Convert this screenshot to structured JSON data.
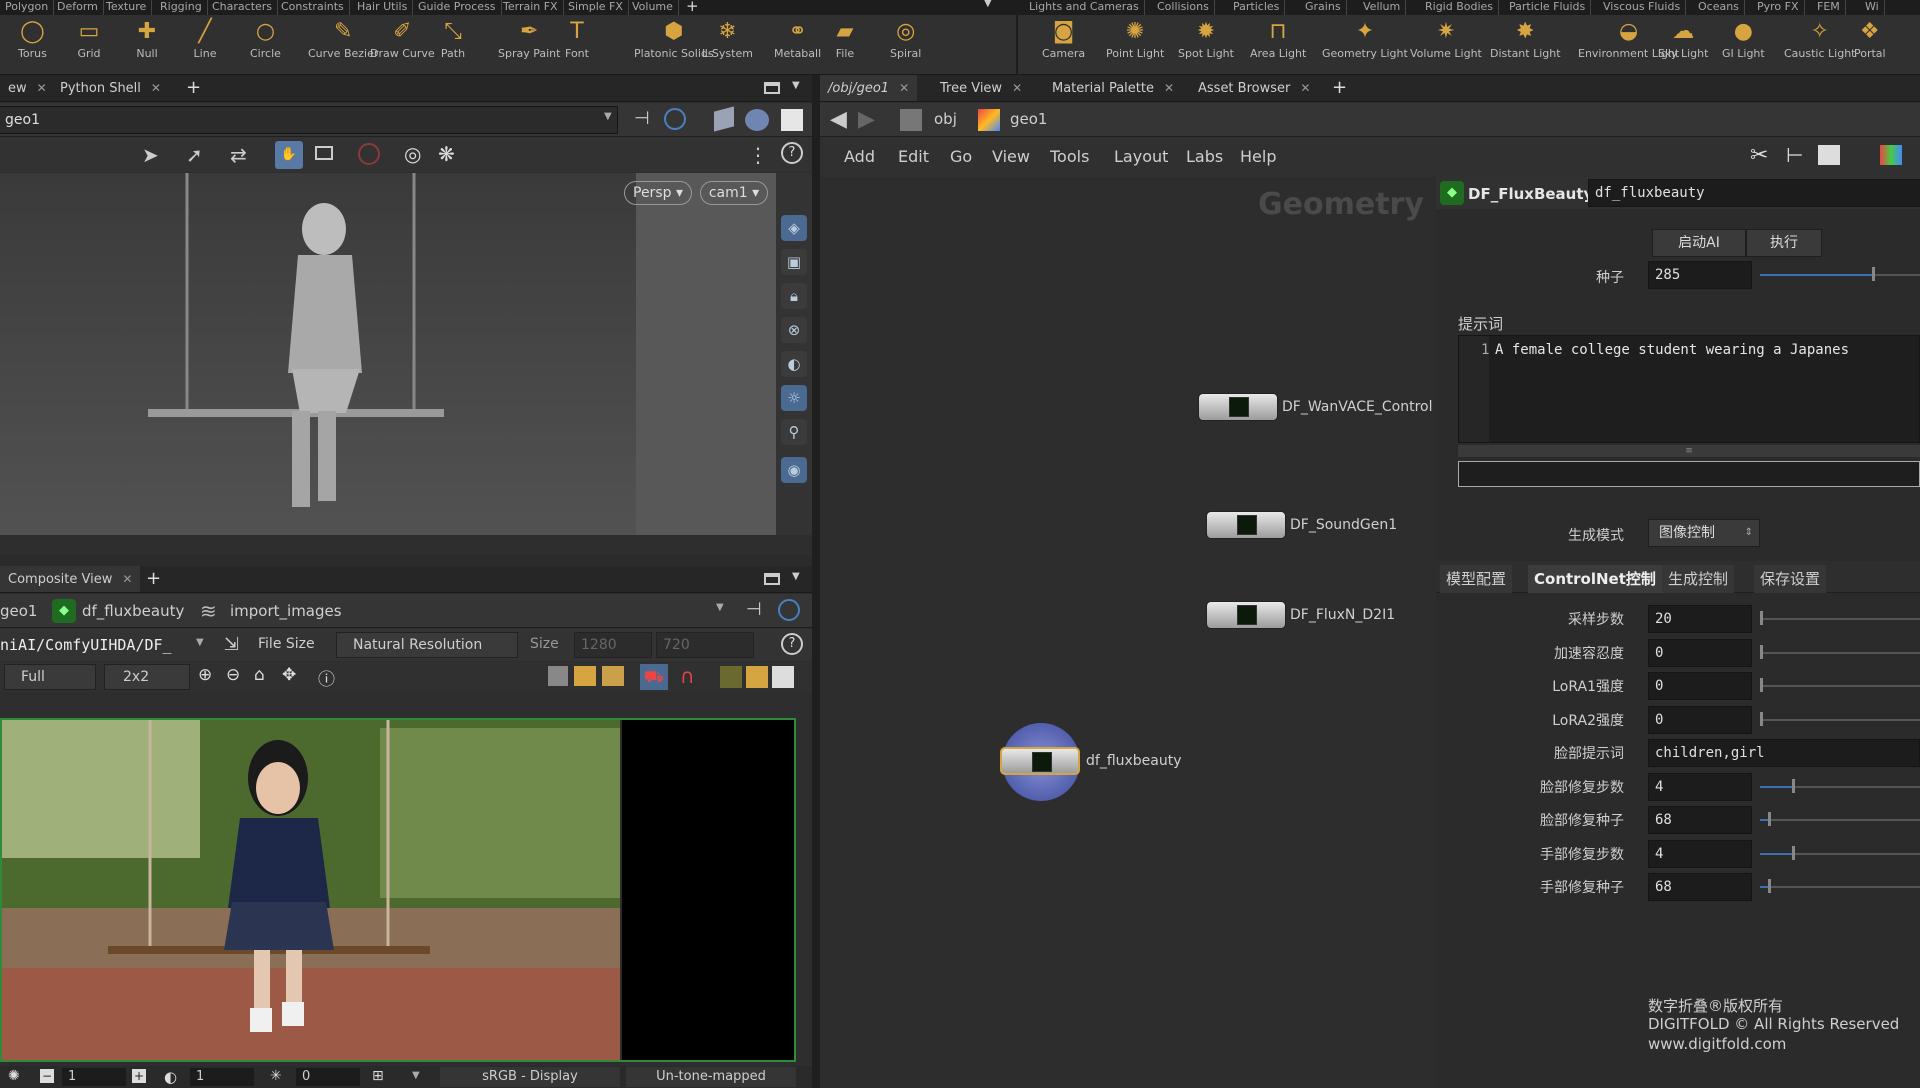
{
  "shelf_tabs_left": [
    "Polygon",
    "Deform",
    "Texture",
    "Rigging",
    "Characters",
    "Constraints",
    "Hair Utils",
    "Guide Process",
    "Terrain FX",
    "Simple FX",
    "Volume"
  ],
  "shelf_tabs_right": [
    "Lights and Cameras",
    "Collisions",
    "Particles",
    "Grains",
    "Vellum",
    "Rigid Bodies",
    "Particle Fluids",
    "Viscous Fluids",
    "Oceans",
    "Pyro FX",
    "FEM",
    "Wi"
  ],
  "tools_left": [
    {
      "label": "Torus",
      "icon": "torus-icon",
      "glyph": "◯"
    },
    {
      "label": "Grid",
      "icon": "grid-icon",
      "glyph": "▭"
    },
    {
      "label": "Null",
      "icon": "null-icon",
      "glyph": "✚"
    },
    {
      "label": "Line",
      "icon": "line-icon",
      "glyph": "╱"
    },
    {
      "label": "Circle",
      "icon": "circle-icon",
      "glyph": "○"
    },
    {
      "label": "Curve Bezier",
      "icon": "curve-bezier-icon",
      "glyph": "✎"
    },
    {
      "label": "Draw Curve",
      "icon": "draw-curve-icon",
      "glyph": "✐"
    },
    {
      "label": "Path",
      "icon": "path-icon",
      "glyph": "⤡"
    },
    {
      "label": "Spray Paint",
      "icon": "spray-paint-icon",
      "glyph": "✒"
    },
    {
      "label": "Font",
      "icon": "font-icon",
      "glyph": "T"
    },
    {
      "label": "Platonic Solids",
      "icon": "platonic-solids-icon",
      "glyph": "⬢"
    },
    {
      "label": "L-System",
      "icon": "l-system-icon",
      "glyph": "❄"
    },
    {
      "label": "Metaball",
      "icon": "metaball-icon",
      "glyph": "⚭"
    },
    {
      "label": "File",
      "icon": "file-icon",
      "glyph": "▰"
    },
    {
      "label": "Spiral",
      "icon": "spiral-icon",
      "glyph": "◎"
    }
  ],
  "tools_right": [
    {
      "label": "Camera",
      "icon": "camera-icon",
      "glyph": "◙"
    },
    {
      "label": "Point Light",
      "icon": "point-light-icon",
      "glyph": "✺"
    },
    {
      "label": "Spot Light",
      "icon": "spot-light-icon",
      "glyph": "✹"
    },
    {
      "label": "Area Light",
      "icon": "area-light-icon",
      "glyph": "⊓"
    },
    {
      "label": "Geometry Light",
      "icon": "geometry-light-icon",
      "glyph": "✦"
    },
    {
      "label": "Volume Light",
      "icon": "volume-light-icon",
      "glyph": "✷"
    },
    {
      "label": "Distant Light",
      "icon": "distant-light-icon",
      "glyph": "✸"
    },
    {
      "label": "Environment Light",
      "icon": "environment-light-icon",
      "glyph": "◒"
    },
    {
      "label": "Sky Light",
      "icon": "sky-light-icon",
      "glyph": "☁"
    },
    {
      "label": "GI Light",
      "icon": "gi-light-icon",
      "glyph": "●"
    },
    {
      "label": "Caustic Light",
      "icon": "caustic-light-icon",
      "glyph": "✧"
    },
    {
      "label": "Portal",
      "icon": "portal-light-icon",
      "glyph": "❖"
    }
  ],
  "left_top": {
    "tabs": [
      "ew",
      "Python Shell"
    ],
    "path": "geo1",
    "camera_menu": "Persp",
    "cam_menu": "cam1"
  },
  "left_bottom": {
    "tab": "Composite View",
    "crumbs": [
      "geo1",
      "df_fluxbeauty",
      "import_images"
    ],
    "path": "niAI/ComfyUIHDA/DF_",
    "size_mode": "File Size",
    "resolution": "Natural Resolution",
    "size_label": "Size",
    "width": "1280",
    "height": "720",
    "zoom": "Full",
    "grid": "2x2",
    "bottom": {
      "val1": "1",
      "val2": "1",
      "val3": "0",
      "display": "sRGB - Display",
      "tonemap": "Un-tone-mapped"
    }
  },
  "network": {
    "tabs": [
      "/obj/geo1",
      "Tree View",
      "Material Palette",
      "Asset Browser"
    ],
    "crumbs": [
      "obj",
      "geo1"
    ],
    "menu": [
      "Add",
      "Edit",
      "Go",
      "View",
      "Tools",
      "Layout",
      "Labs",
      "Help"
    ],
    "watermark": "Geometry",
    "nodes": [
      "DF_WanVACE_Control",
      "DF_SoundGen1",
      "DF_FluxN_D2I1",
      "df_fluxbeauty"
    ]
  },
  "params": {
    "node_type": "DF_FluxBeauty",
    "node_name": "df_fluxbeauty",
    "btn_start": "启动AI",
    "btn_run": "执行",
    "seed_label": "种子",
    "seed": "285",
    "seed_fraction": 0.5,
    "prompt_label": "提示词",
    "prompt_line": "1",
    "prompt_text": "A female college student wearing a Japanes",
    "mode_label": "生成模式",
    "mode_value": "图像控制",
    "tabs": [
      "模型配置",
      "ControlNet控制",
      "生成控制",
      "保存设置"
    ],
    "rows": [
      {
        "label": "采样步数",
        "value": "20"
      },
      {
        "label": "加速容忍度",
        "value": "0"
      },
      {
        "label": "LoRA1强度",
        "value": "0"
      },
      {
        "label": "LoRA2强度",
        "value": "0"
      },
      {
        "label": "脸部提示词",
        "value": "children,girl"
      },
      {
        "label": "脸部修复步数",
        "value": "4"
      },
      {
        "label": "脸部修复种子",
        "value": "68"
      },
      {
        "label": "手部修复步数",
        "value": "4"
      },
      {
        "label": "手部修复种子",
        "value": "68"
      }
    ],
    "copyright_cn": "数字折叠®版权所有",
    "copyright_en": "DIGITFOLD © All Rights Reserved",
    "website": "www.digitfold.com"
  },
  "colors": {
    "accent": "#3d6fb5",
    "node_select": "#d6a441"
  }
}
